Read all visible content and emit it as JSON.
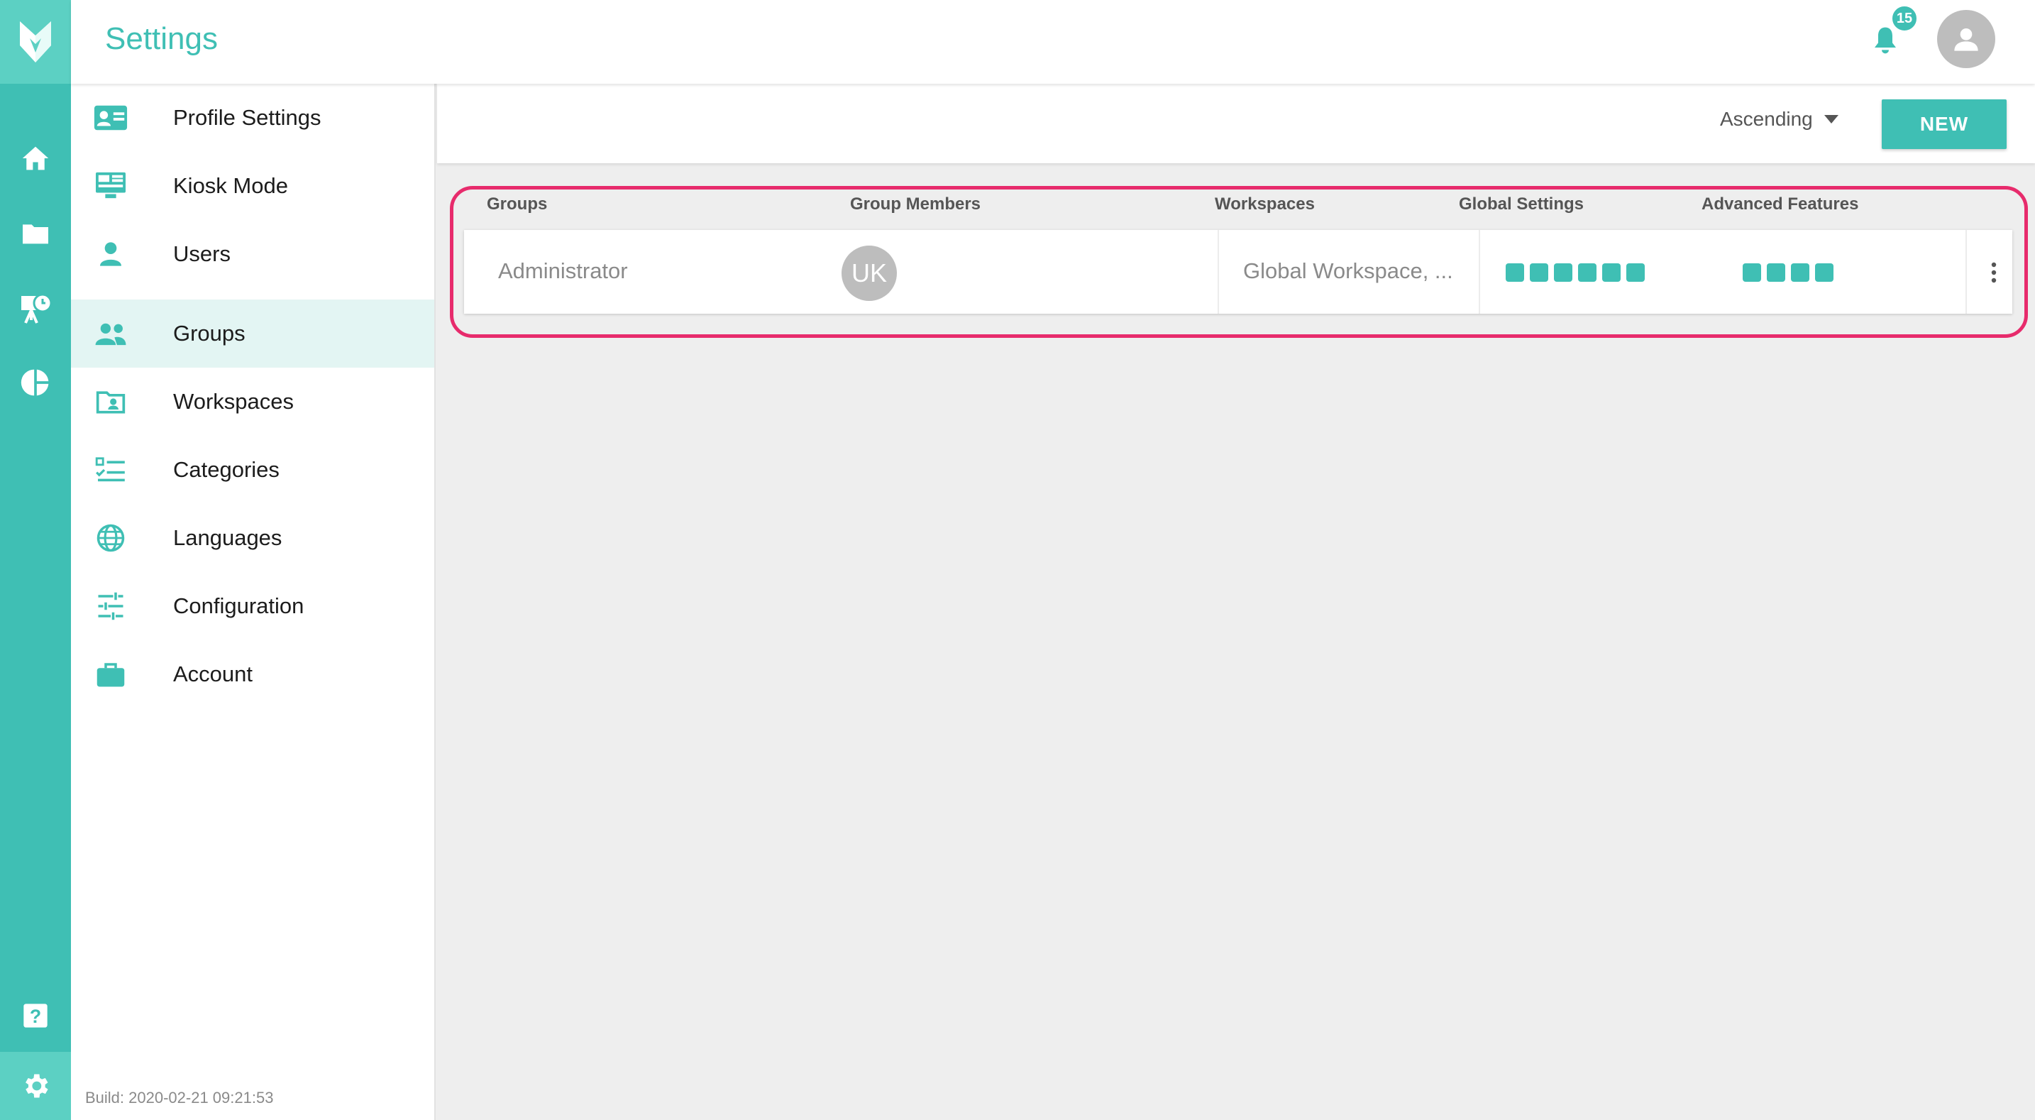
{
  "header": {
    "title": "Settings",
    "notification_count": "15"
  },
  "sidebar": {
    "items": [
      {
        "label": "Profile Settings",
        "icon": "profile-card-icon"
      },
      {
        "label": "Kiosk Mode",
        "icon": "monitor-icon"
      },
      {
        "label": "Users",
        "icon": "user-icon"
      },
      {
        "label": "Groups",
        "icon": "group-icon",
        "active": true
      },
      {
        "label": "Workspaces",
        "icon": "workspace-folder-icon"
      },
      {
        "label": "Categories",
        "icon": "checklist-icon"
      },
      {
        "label": "Languages",
        "icon": "globe-icon"
      },
      {
        "label": "Configuration",
        "icon": "sliders-icon"
      },
      {
        "label": "Account",
        "icon": "briefcase-icon"
      }
    ],
    "build": "Build: 2020-02-21 09:21:53"
  },
  "toolbar": {
    "sort_label": "Ascending",
    "new_label": "NEW"
  },
  "table": {
    "columns": [
      "Groups",
      "Group Members",
      "Workspaces",
      "Global Settings",
      "Advanced Features"
    ],
    "rows": [
      {
        "group": "Administrator",
        "member_initials": "UK",
        "workspaces": "Global Workspace, ...",
        "global_settings_count": 6,
        "advanced_features_count": 4
      }
    ]
  },
  "colors": {
    "accent": "#3fbfb4",
    "accent_light": "#5cd0c3",
    "highlight": "#e72b6c"
  }
}
